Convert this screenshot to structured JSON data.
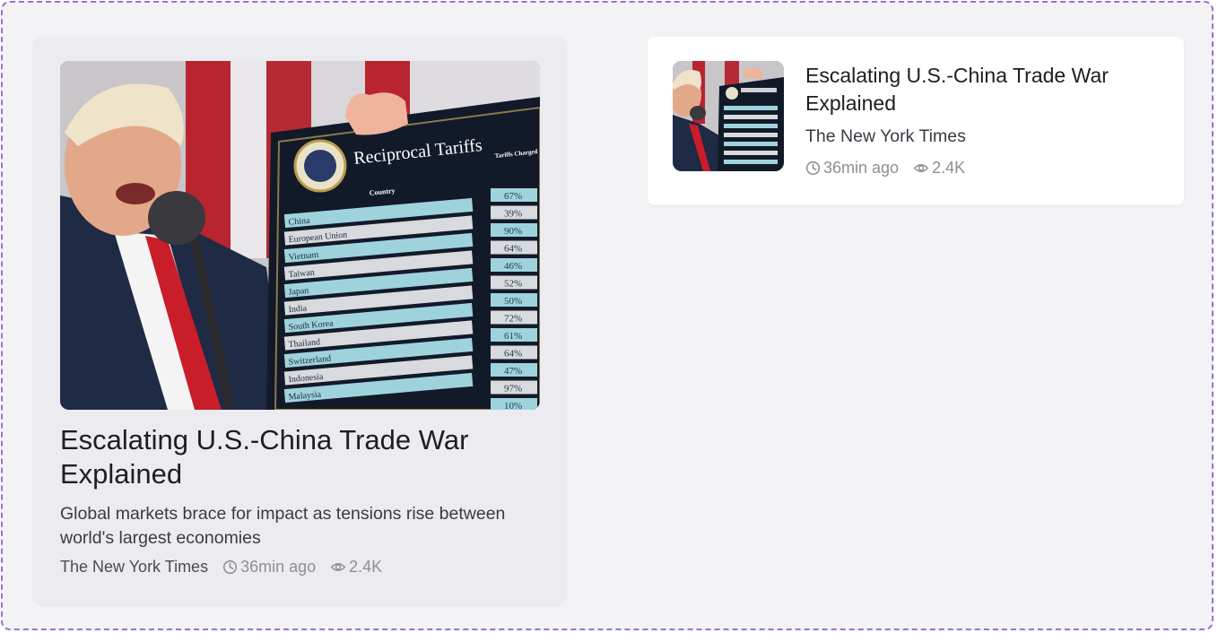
{
  "featured": {
    "title": "Escalating U.S.-China Trade War Explained",
    "description": "Global markets brace for impact as tensions rise between world's largest economies",
    "source": "The New York Times",
    "time_ago": "36min ago",
    "views": "2.4K",
    "image": {
      "sign_title": "Reciprocal Tariffs",
      "sign_col_header": "Country",
      "sign_side_header": "Tariffs Charged to the U.S.A.",
      "countries": [
        "China",
        "European Union",
        "Vietnam",
        "Taiwan",
        "Japan",
        "India",
        "South Korea",
        "Thailand",
        "Switzerland",
        "Indonesia",
        "Malaysia"
      ],
      "tariffs": [
        "67%",
        "39%",
        "90%",
        "64%",
        "46%",
        "52%",
        "50%",
        "72%",
        "61%",
        "64%",
        "47%",
        "97%",
        "10%"
      ]
    }
  },
  "compact": {
    "title": "Escalating U.S.-China Trade War Explained",
    "source": "The New York Times",
    "time_ago": "36min ago",
    "views": "2.4K"
  },
  "colors": {
    "frame_border": "#9b6fd6",
    "background": "#f3f3f5",
    "meta_gray": "#8e8e96"
  }
}
